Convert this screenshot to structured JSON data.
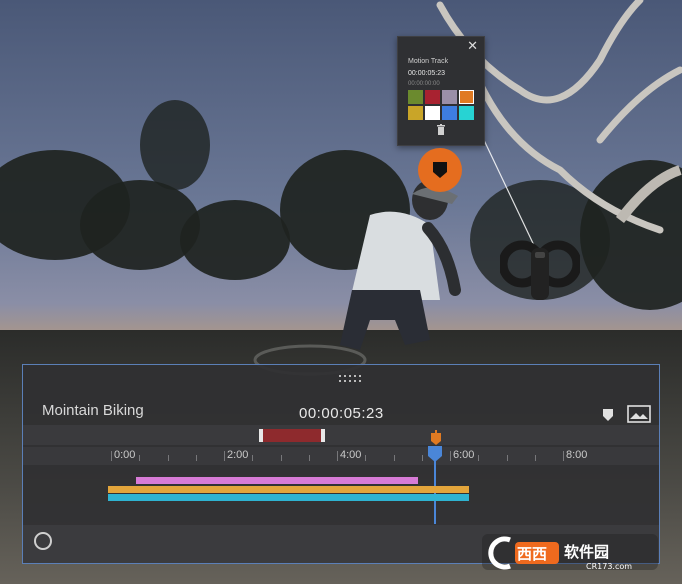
{
  "motion_panel": {
    "title": "Motion Track",
    "time": "00:00:05:23",
    "sub_time": "00:00:00:00",
    "close_icon": "close-icon",
    "trash_icon": "trash-icon",
    "swatches": [
      "#6b8a2e",
      "#a82230",
      "#9a8fa8",
      "#e07a22",
      "#c9a528",
      "#ffffff",
      "#3e7de0",
      "#27d3d3"
    ],
    "selected_swatch": 3
  },
  "marker_button": {
    "color": "#e56d1f",
    "icon": "marker-icon"
  },
  "timeline": {
    "clip_title": "Mointain Biking",
    "timecode": "00:00:05:23",
    "ruler_labels": [
      "0:00",
      "2:00",
      "4:00",
      "6:00",
      "8:00"
    ],
    "tracks": [
      {
        "color": "#d77bd6"
      },
      {
        "color": "#e3a53b"
      },
      {
        "color": "#2fb3d1"
      }
    ],
    "accent": "#4a86d8",
    "marker_color": "#e07a22",
    "clip_color": "#8e2a2d"
  },
  "watermark": {
    "text_cn": "软件园",
    "brand": "西西",
    "url": "CR173.com"
  }
}
